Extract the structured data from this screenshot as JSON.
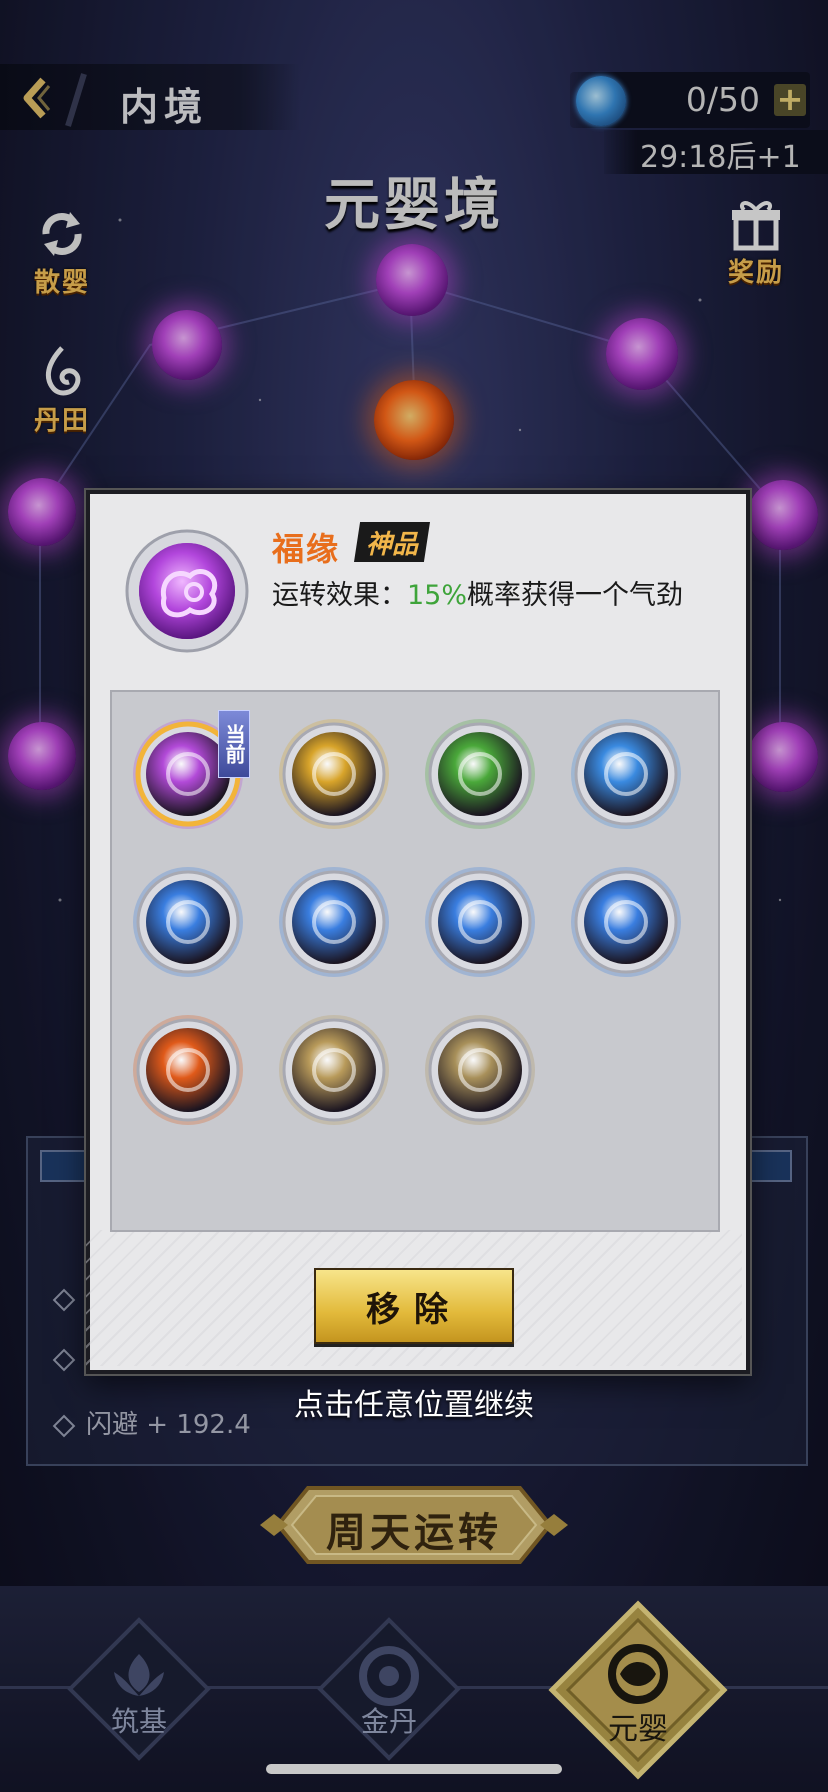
{
  "header": {
    "back_icon": "chevron-left-icon",
    "title": "内境",
    "resource_icon": "vortex-orb-icon",
    "resource_count": "0/50",
    "plus_label": "+",
    "timer": "29:18后+1"
  },
  "realm_title": "元婴境",
  "left_buttons": [
    {
      "label": "散婴",
      "icon": "refresh-icon"
    },
    {
      "label": "丹田",
      "icon": "flame-swirl-icon"
    }
  ],
  "right_buttons": [
    {
      "label": "奖励",
      "icon": "gift-icon"
    }
  ],
  "stats": {
    "visible_row": "闪避 + 192.4"
  },
  "action_button": "周天运转",
  "bottom_nav": [
    {
      "label": "筑基",
      "icon": "lotus-icon",
      "active": false
    },
    {
      "label": "金丹",
      "icon": "golden-core-icon",
      "active": false
    },
    {
      "label": "元婴",
      "icon": "nascent-soul-icon",
      "active": true
    }
  ],
  "dialog": {
    "selected_icon": "fortune-cloud-icon",
    "name": "福缘",
    "grade": "神品",
    "effect_prefix": "运转效果：",
    "effect_percent": "15%",
    "effect_suffix": "概率获得一个气劲",
    "current_tag": "当前",
    "remove_label": "移除",
    "slots": [
      {
        "icon": "fortune-cloud-icon",
        "color": "#b24ad8",
        "current": true
      },
      {
        "icon": "golden-figure-icon",
        "color": "#d8a42a",
        "current": false
      },
      {
        "icon": "green-dragon-icon",
        "color": "#4aa83a",
        "current": false
      },
      {
        "icon": "blue-vortex-icon",
        "color": "#3a8ae0",
        "current": false
      },
      {
        "icon": "blue-sun-icon",
        "color": "#3a7ee0",
        "current": false
      },
      {
        "icon": "blue-sun-icon",
        "color": "#3a7ee0",
        "current": false
      },
      {
        "icon": "blue-sun-icon",
        "color": "#3a7ee0",
        "current": false
      },
      {
        "icon": "blue-sun-icon",
        "color": "#3a7ee0",
        "current": false
      },
      {
        "icon": "fire-icon",
        "color": "#e05a1a",
        "current": false
      },
      {
        "icon": "stone-shield-icon",
        "color": "#b89a5a",
        "current": false
      },
      {
        "icon": "stone-crystals-icon",
        "color": "#a8905a",
        "current": false
      }
    ]
  },
  "continue_hint": "点击任意位置继续",
  "colors": {
    "accent_orange": "#e86e1c",
    "effect_green": "#3ea43a",
    "gold": "#f2c05a"
  }
}
